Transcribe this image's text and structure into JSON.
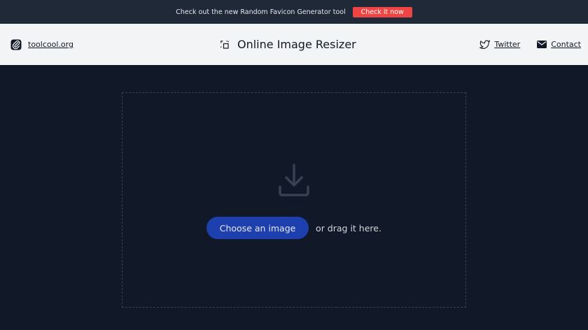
{
  "promo": {
    "text": "Check out the new Random Favicon Generator tool",
    "button_label": "Check it now",
    "button_color": "#ef4444"
  },
  "header": {
    "brand_label": "toolcool.org",
    "brand_icon": "paperclip-icon",
    "title": "Online Image Resizer",
    "title_icon": "resize-icon",
    "nav": {
      "twitter_label": "Twitter",
      "contact_label": "Contact"
    }
  },
  "upload": {
    "icon": "download-icon",
    "button_label": "Choose an image",
    "hint": "or drag it here."
  },
  "colors": {
    "background": "#111827",
    "header_bg": "#f3f4f6",
    "accent": "#1e40af"
  }
}
